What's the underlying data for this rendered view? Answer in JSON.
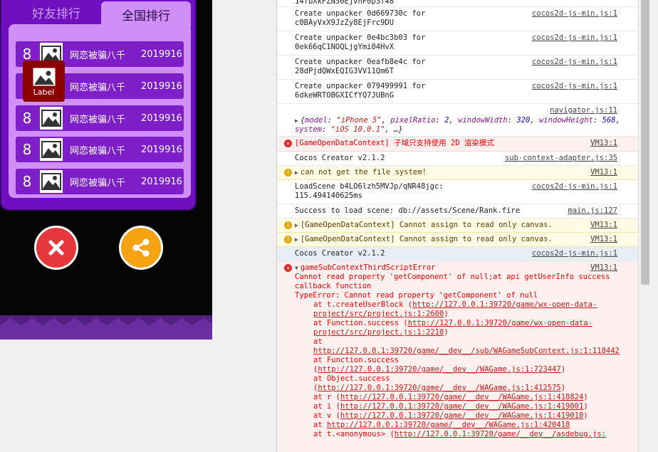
{
  "game": {
    "tabs": {
      "friends": "好友排行",
      "global": "全国排行"
    },
    "rows": [
      {
        "rank": "8",
        "name": "网恋被骗八千",
        "score": "2019916"
      },
      {
        "rank": "8",
        "name": "网恋被骗八千",
        "score": "2019916"
      },
      {
        "rank": "8",
        "name": "网恋被骗八千",
        "score": "2019916"
      },
      {
        "rank": "8",
        "name": "网恋被骗八千",
        "score": "2019916"
      },
      {
        "rank": "8",
        "name": "网恋被骗八千",
        "score": "2019916"
      }
    ],
    "label_widget": "Label",
    "colors": {
      "board": "#6f0fc0",
      "list_bg": "#cf8ff7",
      "row": "#7e1ec8",
      "close": "#e6373d",
      "share": "#f5a312"
    }
  },
  "console": {
    "messages": [
      {
        "text": "14TbXkFZN50EjvhF0p3f48",
        "src": ""
      },
      {
        "text": "Create unpacker 0d669730c for c0BAyVxX9JzZy8EjFrc9DU",
        "src": "cocos2d-js-min.js:1"
      },
      {
        "text": "Create unpacker 0e4bc3b03 for 0ek66qC1NOQLjgYmi04HvX",
        "src": "cocos2d-js-min.js:1"
      },
      {
        "text": "Create unpacker 0eafb8e4c for 28dPjdQWxEQIG3VV11Qm6T",
        "src": "cocos2d-js-min.js:1"
      },
      {
        "text": "Create unpacker 079499991 for 6dkeWRTOBGXICfYQ7JUBnG",
        "src": "cocos2d-js-min.js:1"
      }
    ],
    "navigator": {
      "src": "navigator.js:11",
      "open": "{",
      "k1": "model",
      "v1": "\"iPhone 5\"",
      "k2": "pixelRatio",
      "v2": "2",
      "k3": "windowWidth",
      "v3": "320",
      "k4": "windowHeight",
      "v4": "568",
      "k5": "system",
      "v5": "\"iOS 10.0.1\"",
      "close": ", …}"
    },
    "err1": {
      "text": "[GameOpenDataContext] 子域只支持使用 2D 渲染模式",
      "src": "VM13:1"
    },
    "info1": {
      "text": "Cocos Creator v2.1.2",
      "src": "sub-context-adapter.js:35"
    },
    "warn1": {
      "text": "can not get the file system!",
      "src": "VM13:1"
    },
    "load": {
      "text": "LoadScene b4LO6lzh5MVJp/qNR48jgc: 115.494140625ms",
      "src": "cocos2d-js-min.js:1"
    },
    "success": {
      "text": "Success to load scene: db://assets/Scene/Rank.fire",
      "src": "main.js:127"
    },
    "warn2": {
      "text": "[GameOpenDataContext] Cannot assign to read only canvas.",
      "src": "VM13:1"
    },
    "warn3": {
      "text": "[GameOpenDataContext] Cannot assign to read only canvas.",
      "src": "VM13:1"
    },
    "info2": {
      "text": "Cocos Creator v2.1.2",
      "src": "cocos2d-js-min.js:1"
    },
    "bigerr": {
      "src": "VM13:1",
      "title": "gameSubContextThirdScriptError",
      "line1": "Cannot read property 'getComponent' of null;at api getUserInfo success callback function",
      "line2": "TypeError: Cannot read property 'getComponent' of null",
      "stack": [
        {
          "pre": "at t.createUserBlock (",
          "url": "http://127.0.0.1:39720/game/wx-open-data-project/src/project.js:1:2600",
          "post": ")"
        },
        {
          "pre": "at Function.success (",
          "url": "http://127.0.0.1:39720/game/wx-open-data-project/src/project.js:1:2210",
          "post": ")"
        },
        {
          "pre": "at ",
          "url": "http://127.0.0.1:39720/game/__dev__/sub/WAGameSubContext.js:1:118442",
          "post": ""
        },
        {
          "pre": "at Function.success (",
          "url": "http://127.0.0.1:39720/game/__dev__/WAGame.js:1:723447",
          "post": ")"
        },
        {
          "pre": "at Object.success (",
          "url": "http://127.0.0.1:39720/game/__dev__/WAGame.js:1:412575",
          "post": ")"
        },
        {
          "pre": "at r (",
          "url": "http://127.0.0.1:39720/game/__dev__/WAGame.js:1:418824",
          "post": ")"
        },
        {
          "pre": "at i (",
          "url": "http://127.0.0.1:39720/game/__dev__/WAGame.js:1:419001",
          "post": ")"
        },
        {
          "pre": "at v (",
          "url": "http://127.0.0.1:39720/game/__dev__/WAGame.js:1:419010",
          "post": ")"
        },
        {
          "pre": "at ",
          "url": "http://127.0.0.1:39720/game/__dev__/WAGame.js:1:420418",
          "post": ""
        },
        {
          "pre": "at t.<anonymous> (",
          "url": "http://127.0.0.1:39720/game/__dev__/asdebug.js:",
          "post": ""
        }
      ]
    }
  }
}
